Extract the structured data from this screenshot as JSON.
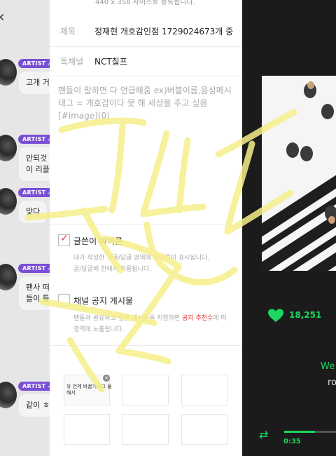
{
  "chat": {
    "back_icon": "chevron-left-icon",
    "badge_label": "ARTIST",
    "messages": [
      {
        "text": "고개 거"
      },
      {
        "text": "안되것\n이 리플"
      },
      {
        "text": "맞다"
      },
      {
        "text": "팬사 떠\n들이 틀"
      },
      {
        "text": "같이 ㅎ"
      }
    ]
  },
  "form": {
    "notice": "440 x 358 사이즈로 등록됩니다.",
    "title_label": "제목",
    "title_value": "정재현 개호감인점 1729024673개 중",
    "channel_label": "톡채널",
    "channel_value": "NCT칠프",
    "content_placeholder_lines": [
      "팬들이 말하면 다 언급해줌 ex)버블이름,음성메시",
      "태그 = 개호감이다 못 해 세상을 주고 싶음",
      "[#image](0)"
    ],
    "author_icon": {
      "label": "글쓴이 아이콘",
      "checked": true,
      "desc_lines": [
        "내가 작성한 댓글/답글 영역에 아이콘이 표시됩니다.",
        "글/답글에 한해서 적용됩니다."
      ]
    },
    "channel_notice": {
      "label": "채널 공지 게시물",
      "checked": false,
      "desc_prefix": "팬들과 공유하고 싶은 게시물을 지정하면 ",
      "desc_highlight": "공지 추천수",
      "desc_suffix": "에 따",
      "desc_line2": "영역에 노출됩니다."
    },
    "attachment_text": "유 언제 바꿀거냐고 물\n해서"
  },
  "player": {
    "like_icon": "heart-icon",
    "likes": "18,251",
    "lyric_line1": "We",
    "lyric_line2": "ro",
    "repeat_icon": "repeat-icon",
    "elapsed": "0:35",
    "progress_fraction": 0.55,
    "accent": "#1ed760"
  },
  "overlay": {
    "handwriting_color": "#f6ef8a"
  }
}
